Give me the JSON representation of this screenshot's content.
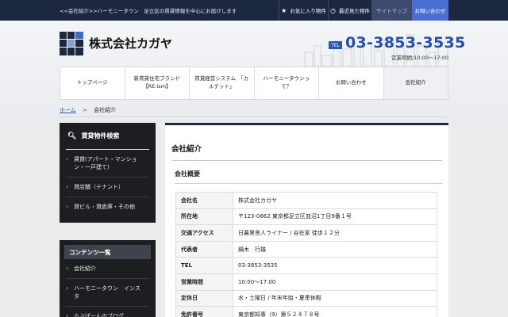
{
  "topbar": {
    "tagline": "<<会社紹介>>ハーモニータウン　足立区の賃貸情報を中心にお届けします",
    "links": {
      "favorites": "お気に入り物件",
      "recent": "最近見た物件",
      "sitemap": "サイトマップ",
      "contact": "お問い合わせ"
    }
  },
  "header": {
    "company": "株式会社カガヤ",
    "tel_label": "TEL",
    "phone": "03-3853-3535",
    "hours": "営業時間/10:00～17:00"
  },
  "nav": [
    "トップページ",
    "新賃貸住宅ブランド【RE:ism】",
    "賃貸経営システム　「カルテット」",
    "ハーモニータウンって？",
    "お問い合わせ",
    "会社紹介"
  ],
  "breadcrumb": {
    "home": "ホーム",
    "separator": ">",
    "current": "会社紹介"
  },
  "sidebar": {
    "search_title": "賃貸物件検索",
    "search_items": [
      "賃貸(アパート・マンション・一戸建て)",
      "貸店舗（テナント）",
      "貸ビル・貸倉庫・その他"
    ],
    "contents_title": "コンテンツ一覧",
    "contents_items": [
      "会社紹介",
      "ハーモニータウン　インスタ",
      "らぶぽーんのブログ"
    ]
  },
  "main": {
    "title": "会社紹介",
    "subtitle": "会社概要",
    "rows": [
      {
        "k": "会社名",
        "v": "株式会社カガヤ"
      },
      {
        "k": "所在地",
        "v": "〒123-0862 東京都足立区皿沼1丁目9番１号"
      },
      {
        "k": "交通アクセス",
        "v": "日暮里舎人ライナー / 谷在家 徒歩１２分"
      },
      {
        "k": "代表者",
        "v": "鍋木　行雄"
      },
      {
        "k": "TEL",
        "v": "03-3853-3535"
      },
      {
        "k": "営業時間",
        "v": "10:00～17:00"
      },
      {
        "k": "定休日",
        "v": "水・土曜日 / 年末年始・夏季休暇"
      },
      {
        "k": "免許番号",
        "v": "東京都知事（9）第５２４７８号"
      }
    ]
  },
  "colors": {
    "topbar": "#1c2740",
    "accent_blue": "#2450a8",
    "contact_button": "#4a6fd2"
  }
}
